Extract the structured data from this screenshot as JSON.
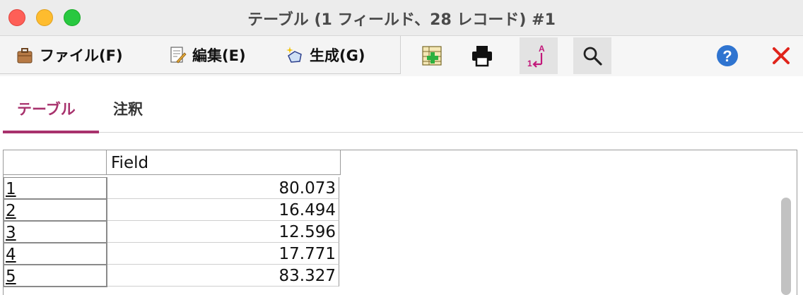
{
  "window": {
    "title": "テーブル (1 フィールド、28 レコード) #1"
  },
  "menu": {
    "file": "ファイル(F)",
    "edit": "編集(E)",
    "generate": "生成(G)"
  },
  "toolbar_icons": {
    "add_record": "add-record-icon",
    "print": "printer-icon",
    "sort": "sort-icon",
    "search": "magnifier-icon",
    "help": "help-icon",
    "close": "close-icon"
  },
  "tabs": [
    {
      "label": "テーブル",
      "active": true
    },
    {
      "label": "注釈",
      "active": false
    }
  ],
  "table": {
    "column_header": "Field",
    "rows": [
      {
        "index": "1",
        "value": "80.073"
      },
      {
        "index": "2",
        "value": "16.494"
      },
      {
        "index": "3",
        "value": "12.596"
      },
      {
        "index": "4",
        "value": "17.771"
      },
      {
        "index": "5",
        "value": "83.327"
      }
    ]
  },
  "colors": {
    "accent": "#a8326d",
    "help_blue": "#2f74d0",
    "close_red": "#e0241b"
  }
}
